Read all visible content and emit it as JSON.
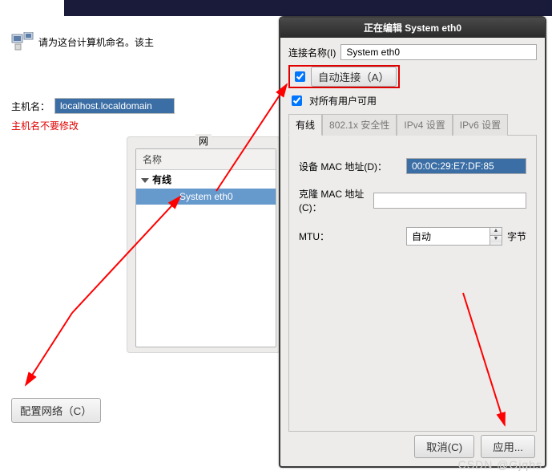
{
  "topbar": {},
  "left": {
    "prompt": "请为这台计算机命名。该主",
    "hostname_label": "主机名：",
    "hostname_value": "localhost.localdomain",
    "warn": "主机名不要修改",
    "configure_network_btn": "配置网络（C）"
  },
  "netpanel": {
    "title": "网",
    "col_name": "名称",
    "group_wired": "有线",
    "item_system_eth0": "System eth0"
  },
  "dialog": {
    "title": "正在编辑 System eth0",
    "conn_name_label": "连接名称(I)",
    "conn_name_value": "System eth0",
    "auto_connect_label": "自动连接（A）",
    "all_users_label": "对所有用户可用",
    "tabs": {
      "wired": "有线",
      "sec": "802.1x 安全性",
      "ipv4": "IPv4 设置",
      "ipv6": "IPv6 设置"
    },
    "wired_tab": {
      "mac_label": "设备 MAC 地址(D)：",
      "mac_value": "00:0C:29:E7:DF:85",
      "clone_mac_label": "克隆 MAC 地址(C)：",
      "clone_mac_value": "",
      "mtu_label": "MTU：",
      "mtu_value": "自动",
      "mtu_unit": "字节"
    },
    "cancel": "取消(C)",
    "apply": "应用..."
  },
  "watermark": "CSDN @Gjqhs"
}
